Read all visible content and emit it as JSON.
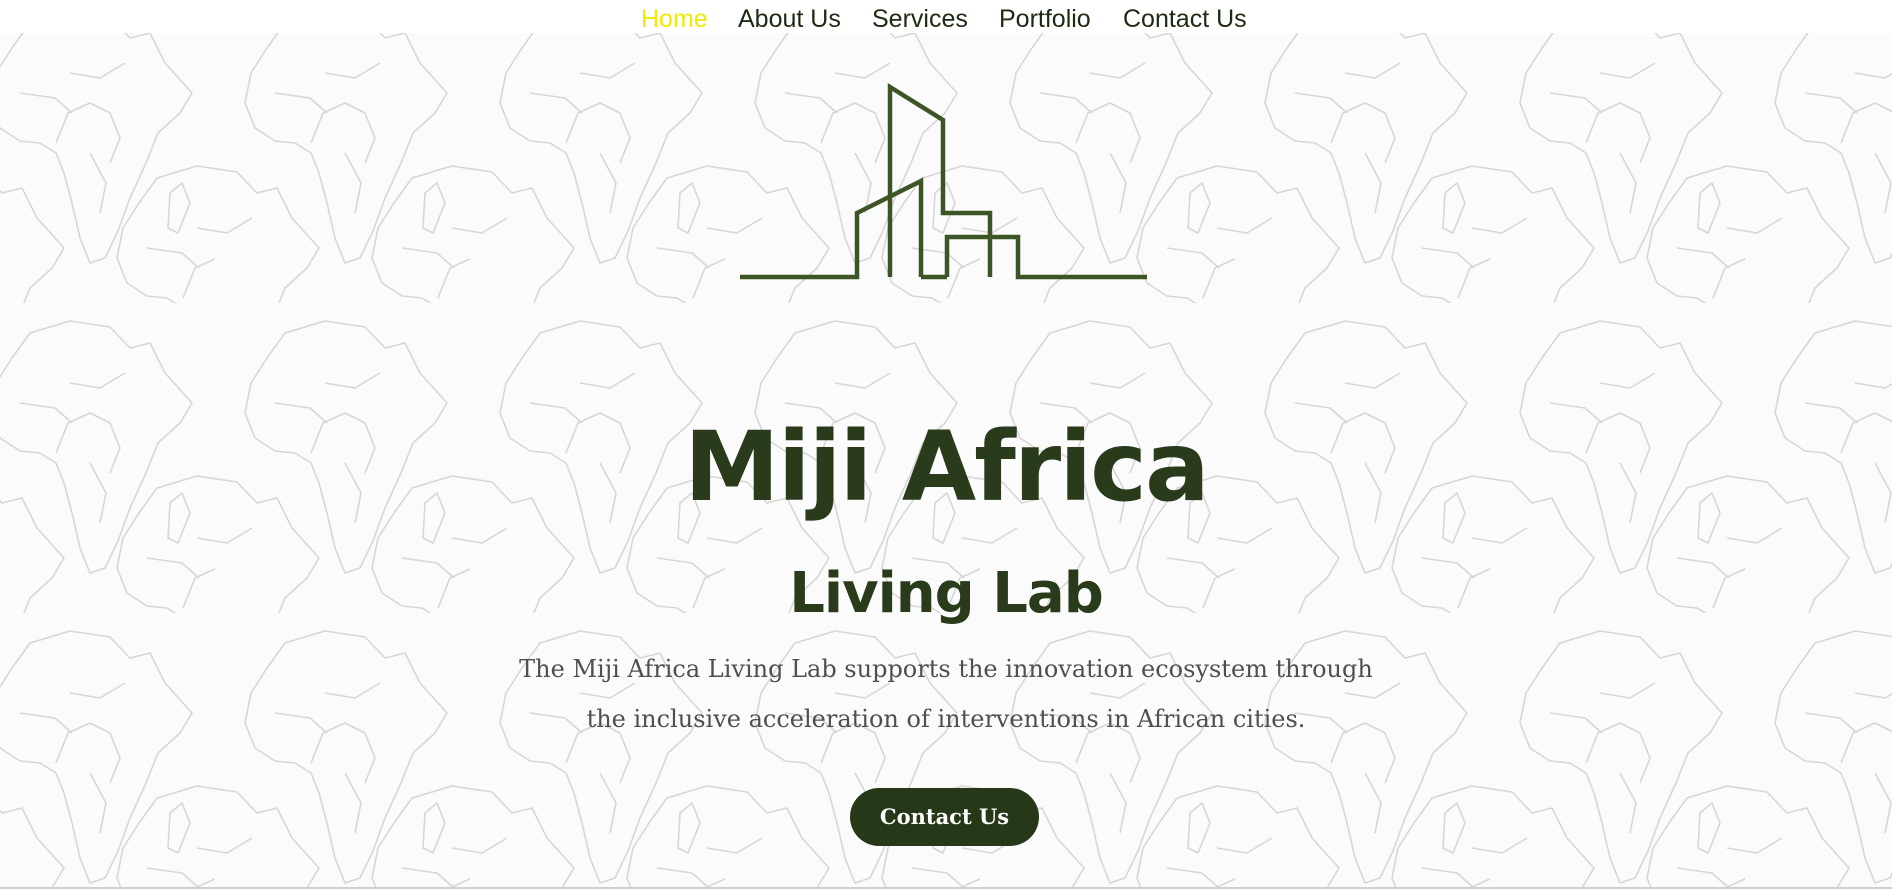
{
  "nav": {
    "items": [
      {
        "label": "Home",
        "active": true
      },
      {
        "label": "About Us",
        "active": false
      },
      {
        "label": "Services",
        "active": false
      },
      {
        "label": "Portfolio",
        "active": false
      },
      {
        "label": "Contact Us",
        "active": false
      }
    ]
  },
  "hero": {
    "title": "Miji Africa",
    "subtitle": "Living Lab",
    "description": "The Miji Africa Living Lab supports the innovation ecosystem through the inclusive acceleration of interventions in African cities.",
    "cta_label": "Contact Us",
    "logo_icon": "city-skyline-icon",
    "background_pattern_icon": "africa-map-pattern"
  },
  "colors": {
    "nav_active": "#f2ea00",
    "nav_text": "#1c2a12",
    "brand_dark_green": "#2a3b1b",
    "logo_green": "#3d5524",
    "button_bg": "#273818",
    "button_text": "#ffffff",
    "body_text": "#4f4f4f",
    "pattern_line": "#d3d3d3"
  }
}
